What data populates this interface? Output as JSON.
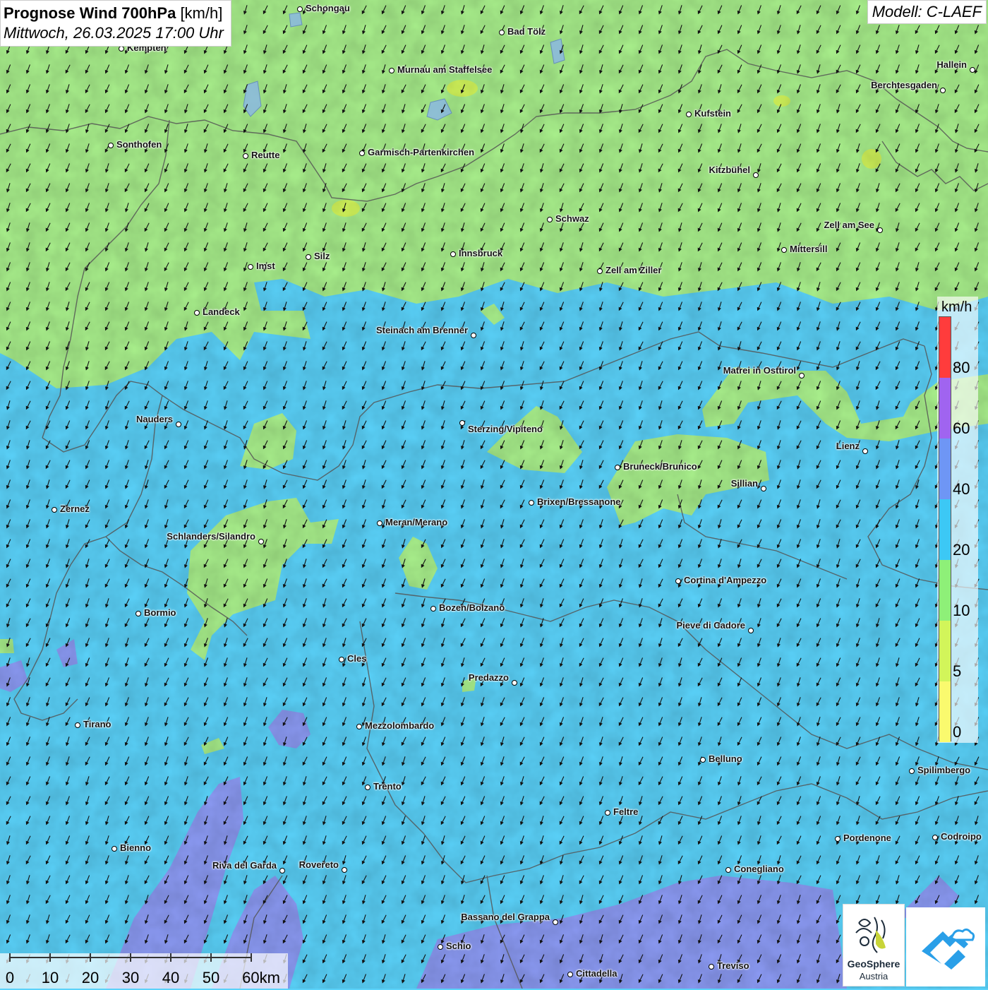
{
  "header": {
    "title": "Prognose Wind 700hPa",
    "unit": "[km/h]",
    "datetime": "Mittwoch, 26.03.2025 17:00 Uhr",
    "model": "Modell: C-LAEF"
  },
  "legend": {
    "unit": "km/h",
    "ticks": [
      "80",
      "60",
      "40",
      "20",
      "10",
      "5",
      "0"
    ],
    "colors": [
      "#ff3c3c",
      "#a064f0",
      "#6e96f5",
      "#3cc8f5",
      "#8ef078",
      "#d2f55a",
      "#fafa6e"
    ]
  },
  "scalebar": {
    "labels": [
      "0",
      "10",
      "20",
      "30",
      "40",
      "50",
      "60km"
    ]
  },
  "colors": {
    "calm_green": "#a9f08c",
    "blue": "#5ad2fa",
    "purple": "#8c9bf5",
    "arrow": "#111111",
    "borders": "#555555"
  },
  "wind": {
    "direction_description": "north-north-easterly flow, arrows point south-south-west",
    "speed_range_kmh": [
      5,
      45
    ]
  },
  "cities": [
    {
      "name": "Schongau"
    },
    {
      "name": "Kempten"
    },
    {
      "name": "Bad Tölz"
    },
    {
      "name": "Murnau am Staffelsee"
    },
    {
      "name": "Hallein"
    },
    {
      "name": "Berchtesgaden"
    },
    {
      "name": "Kufstein"
    },
    {
      "name": "Sonthofen"
    },
    {
      "name": "Reutte"
    },
    {
      "name": "Garmisch-Partenkirchen"
    },
    {
      "name": "Kitzbühel"
    },
    {
      "name": "Schwaz"
    },
    {
      "name": "Zell am See"
    },
    {
      "name": "Mittersill"
    },
    {
      "name": "Imst"
    },
    {
      "name": "Silz"
    },
    {
      "name": "Innsbruck"
    },
    {
      "name": "Zell am Ziller"
    },
    {
      "name": "Landeck"
    },
    {
      "name": "Steinach am Brenner"
    },
    {
      "name": "Matrei in Osttirol"
    },
    {
      "name": "Nauders"
    },
    {
      "name": "Sterzing/Vipiteno"
    },
    {
      "name": "Lienz"
    },
    {
      "name": "Bruneck/Brunico"
    },
    {
      "name": "Sillian"
    },
    {
      "name": "Zernez"
    },
    {
      "name": "Brixen/Bressanone"
    },
    {
      "name": "Meran/Merano"
    },
    {
      "name": "Schlanders/Silandro"
    },
    {
      "name": "Cortina d'Ampezzo"
    },
    {
      "name": "Bozen/Bolzano"
    },
    {
      "name": "Bormio"
    },
    {
      "name": "Pieve di Cadore"
    },
    {
      "name": "Cles"
    },
    {
      "name": "Predazzo"
    },
    {
      "name": "Tirano"
    },
    {
      "name": "Mezzolombardo"
    },
    {
      "name": "Belluno"
    },
    {
      "name": "Spilimbergo"
    },
    {
      "name": "Trento"
    },
    {
      "name": "Feltre"
    },
    {
      "name": "Bienno"
    },
    {
      "name": "Pordenone"
    },
    {
      "name": "Codroipo"
    },
    {
      "name": "Riva del Garda"
    },
    {
      "name": "Rovereto"
    },
    {
      "name": "Conegliano"
    },
    {
      "name": "Bassano del Grappa"
    },
    {
      "name": "Schio"
    },
    {
      "name": "Treviso"
    },
    {
      "name": "Cittadella"
    }
  ],
  "logos": {
    "geosphere_line1": "GeoSphere",
    "geosphere_line2": "Austria"
  }
}
